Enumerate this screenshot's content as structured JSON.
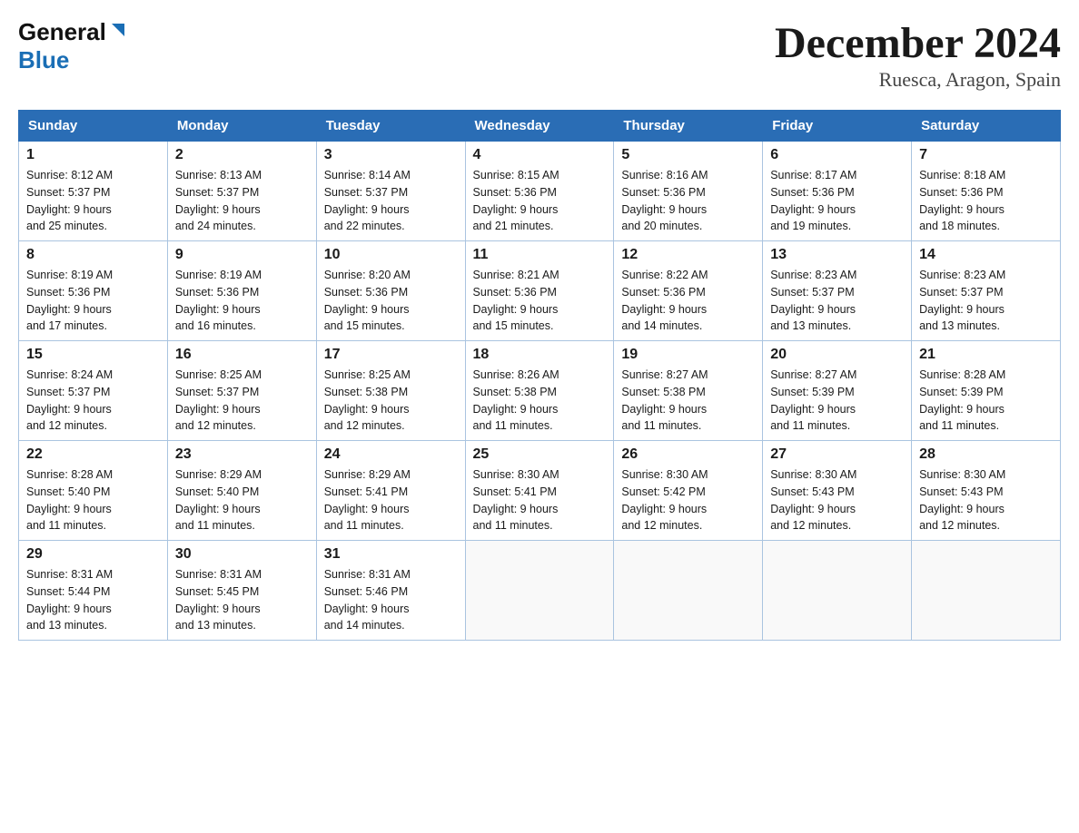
{
  "header": {
    "logo_general": "General",
    "logo_blue": "Blue",
    "month_title": "December 2024",
    "location": "Ruesca, Aragon, Spain"
  },
  "weekdays": [
    "Sunday",
    "Monday",
    "Tuesday",
    "Wednesday",
    "Thursday",
    "Friday",
    "Saturday"
  ],
  "weeks": [
    [
      {
        "day": "1",
        "sunrise": "8:12 AM",
        "sunset": "5:37 PM",
        "daylight": "9 hours and 25 minutes."
      },
      {
        "day": "2",
        "sunrise": "8:13 AM",
        "sunset": "5:37 PM",
        "daylight": "9 hours and 24 minutes."
      },
      {
        "day": "3",
        "sunrise": "8:14 AM",
        "sunset": "5:37 PM",
        "daylight": "9 hours and 22 minutes."
      },
      {
        "day": "4",
        "sunrise": "8:15 AM",
        "sunset": "5:36 PM",
        "daylight": "9 hours and 21 minutes."
      },
      {
        "day": "5",
        "sunrise": "8:16 AM",
        "sunset": "5:36 PM",
        "daylight": "9 hours and 20 minutes."
      },
      {
        "day": "6",
        "sunrise": "8:17 AM",
        "sunset": "5:36 PM",
        "daylight": "9 hours and 19 minutes."
      },
      {
        "day": "7",
        "sunrise": "8:18 AM",
        "sunset": "5:36 PM",
        "daylight": "9 hours and 18 minutes."
      }
    ],
    [
      {
        "day": "8",
        "sunrise": "8:19 AM",
        "sunset": "5:36 PM",
        "daylight": "9 hours and 17 minutes."
      },
      {
        "day": "9",
        "sunrise": "8:19 AM",
        "sunset": "5:36 PM",
        "daylight": "9 hours and 16 minutes."
      },
      {
        "day": "10",
        "sunrise": "8:20 AM",
        "sunset": "5:36 PM",
        "daylight": "9 hours and 15 minutes."
      },
      {
        "day": "11",
        "sunrise": "8:21 AM",
        "sunset": "5:36 PM",
        "daylight": "9 hours and 15 minutes."
      },
      {
        "day": "12",
        "sunrise": "8:22 AM",
        "sunset": "5:36 PM",
        "daylight": "9 hours and 14 minutes."
      },
      {
        "day": "13",
        "sunrise": "8:23 AM",
        "sunset": "5:37 PM",
        "daylight": "9 hours and 13 minutes."
      },
      {
        "day": "14",
        "sunrise": "8:23 AM",
        "sunset": "5:37 PM",
        "daylight": "9 hours and 13 minutes."
      }
    ],
    [
      {
        "day": "15",
        "sunrise": "8:24 AM",
        "sunset": "5:37 PM",
        "daylight": "9 hours and 12 minutes."
      },
      {
        "day": "16",
        "sunrise": "8:25 AM",
        "sunset": "5:37 PM",
        "daylight": "9 hours and 12 minutes."
      },
      {
        "day": "17",
        "sunrise": "8:25 AM",
        "sunset": "5:38 PM",
        "daylight": "9 hours and 12 minutes."
      },
      {
        "day": "18",
        "sunrise": "8:26 AM",
        "sunset": "5:38 PM",
        "daylight": "9 hours and 11 minutes."
      },
      {
        "day": "19",
        "sunrise": "8:27 AM",
        "sunset": "5:38 PM",
        "daylight": "9 hours and 11 minutes."
      },
      {
        "day": "20",
        "sunrise": "8:27 AM",
        "sunset": "5:39 PM",
        "daylight": "9 hours and 11 minutes."
      },
      {
        "day": "21",
        "sunrise": "8:28 AM",
        "sunset": "5:39 PM",
        "daylight": "9 hours and 11 minutes."
      }
    ],
    [
      {
        "day": "22",
        "sunrise": "8:28 AM",
        "sunset": "5:40 PM",
        "daylight": "9 hours and 11 minutes."
      },
      {
        "day": "23",
        "sunrise": "8:29 AM",
        "sunset": "5:40 PM",
        "daylight": "9 hours and 11 minutes."
      },
      {
        "day": "24",
        "sunrise": "8:29 AM",
        "sunset": "5:41 PM",
        "daylight": "9 hours and 11 minutes."
      },
      {
        "day": "25",
        "sunrise": "8:30 AM",
        "sunset": "5:41 PM",
        "daylight": "9 hours and 11 minutes."
      },
      {
        "day": "26",
        "sunrise": "8:30 AM",
        "sunset": "5:42 PM",
        "daylight": "9 hours and 12 minutes."
      },
      {
        "day": "27",
        "sunrise": "8:30 AM",
        "sunset": "5:43 PM",
        "daylight": "9 hours and 12 minutes."
      },
      {
        "day": "28",
        "sunrise": "8:30 AM",
        "sunset": "5:43 PM",
        "daylight": "9 hours and 12 minutes."
      }
    ],
    [
      {
        "day": "29",
        "sunrise": "8:31 AM",
        "sunset": "5:44 PM",
        "daylight": "9 hours and 13 minutes."
      },
      {
        "day": "30",
        "sunrise": "8:31 AM",
        "sunset": "5:45 PM",
        "daylight": "9 hours and 13 minutes."
      },
      {
        "day": "31",
        "sunrise": "8:31 AM",
        "sunset": "5:46 PM",
        "daylight": "9 hours and 14 minutes."
      },
      null,
      null,
      null,
      null
    ]
  ],
  "labels": {
    "sunrise": "Sunrise:",
    "sunset": "Sunset:",
    "daylight": "Daylight:"
  }
}
